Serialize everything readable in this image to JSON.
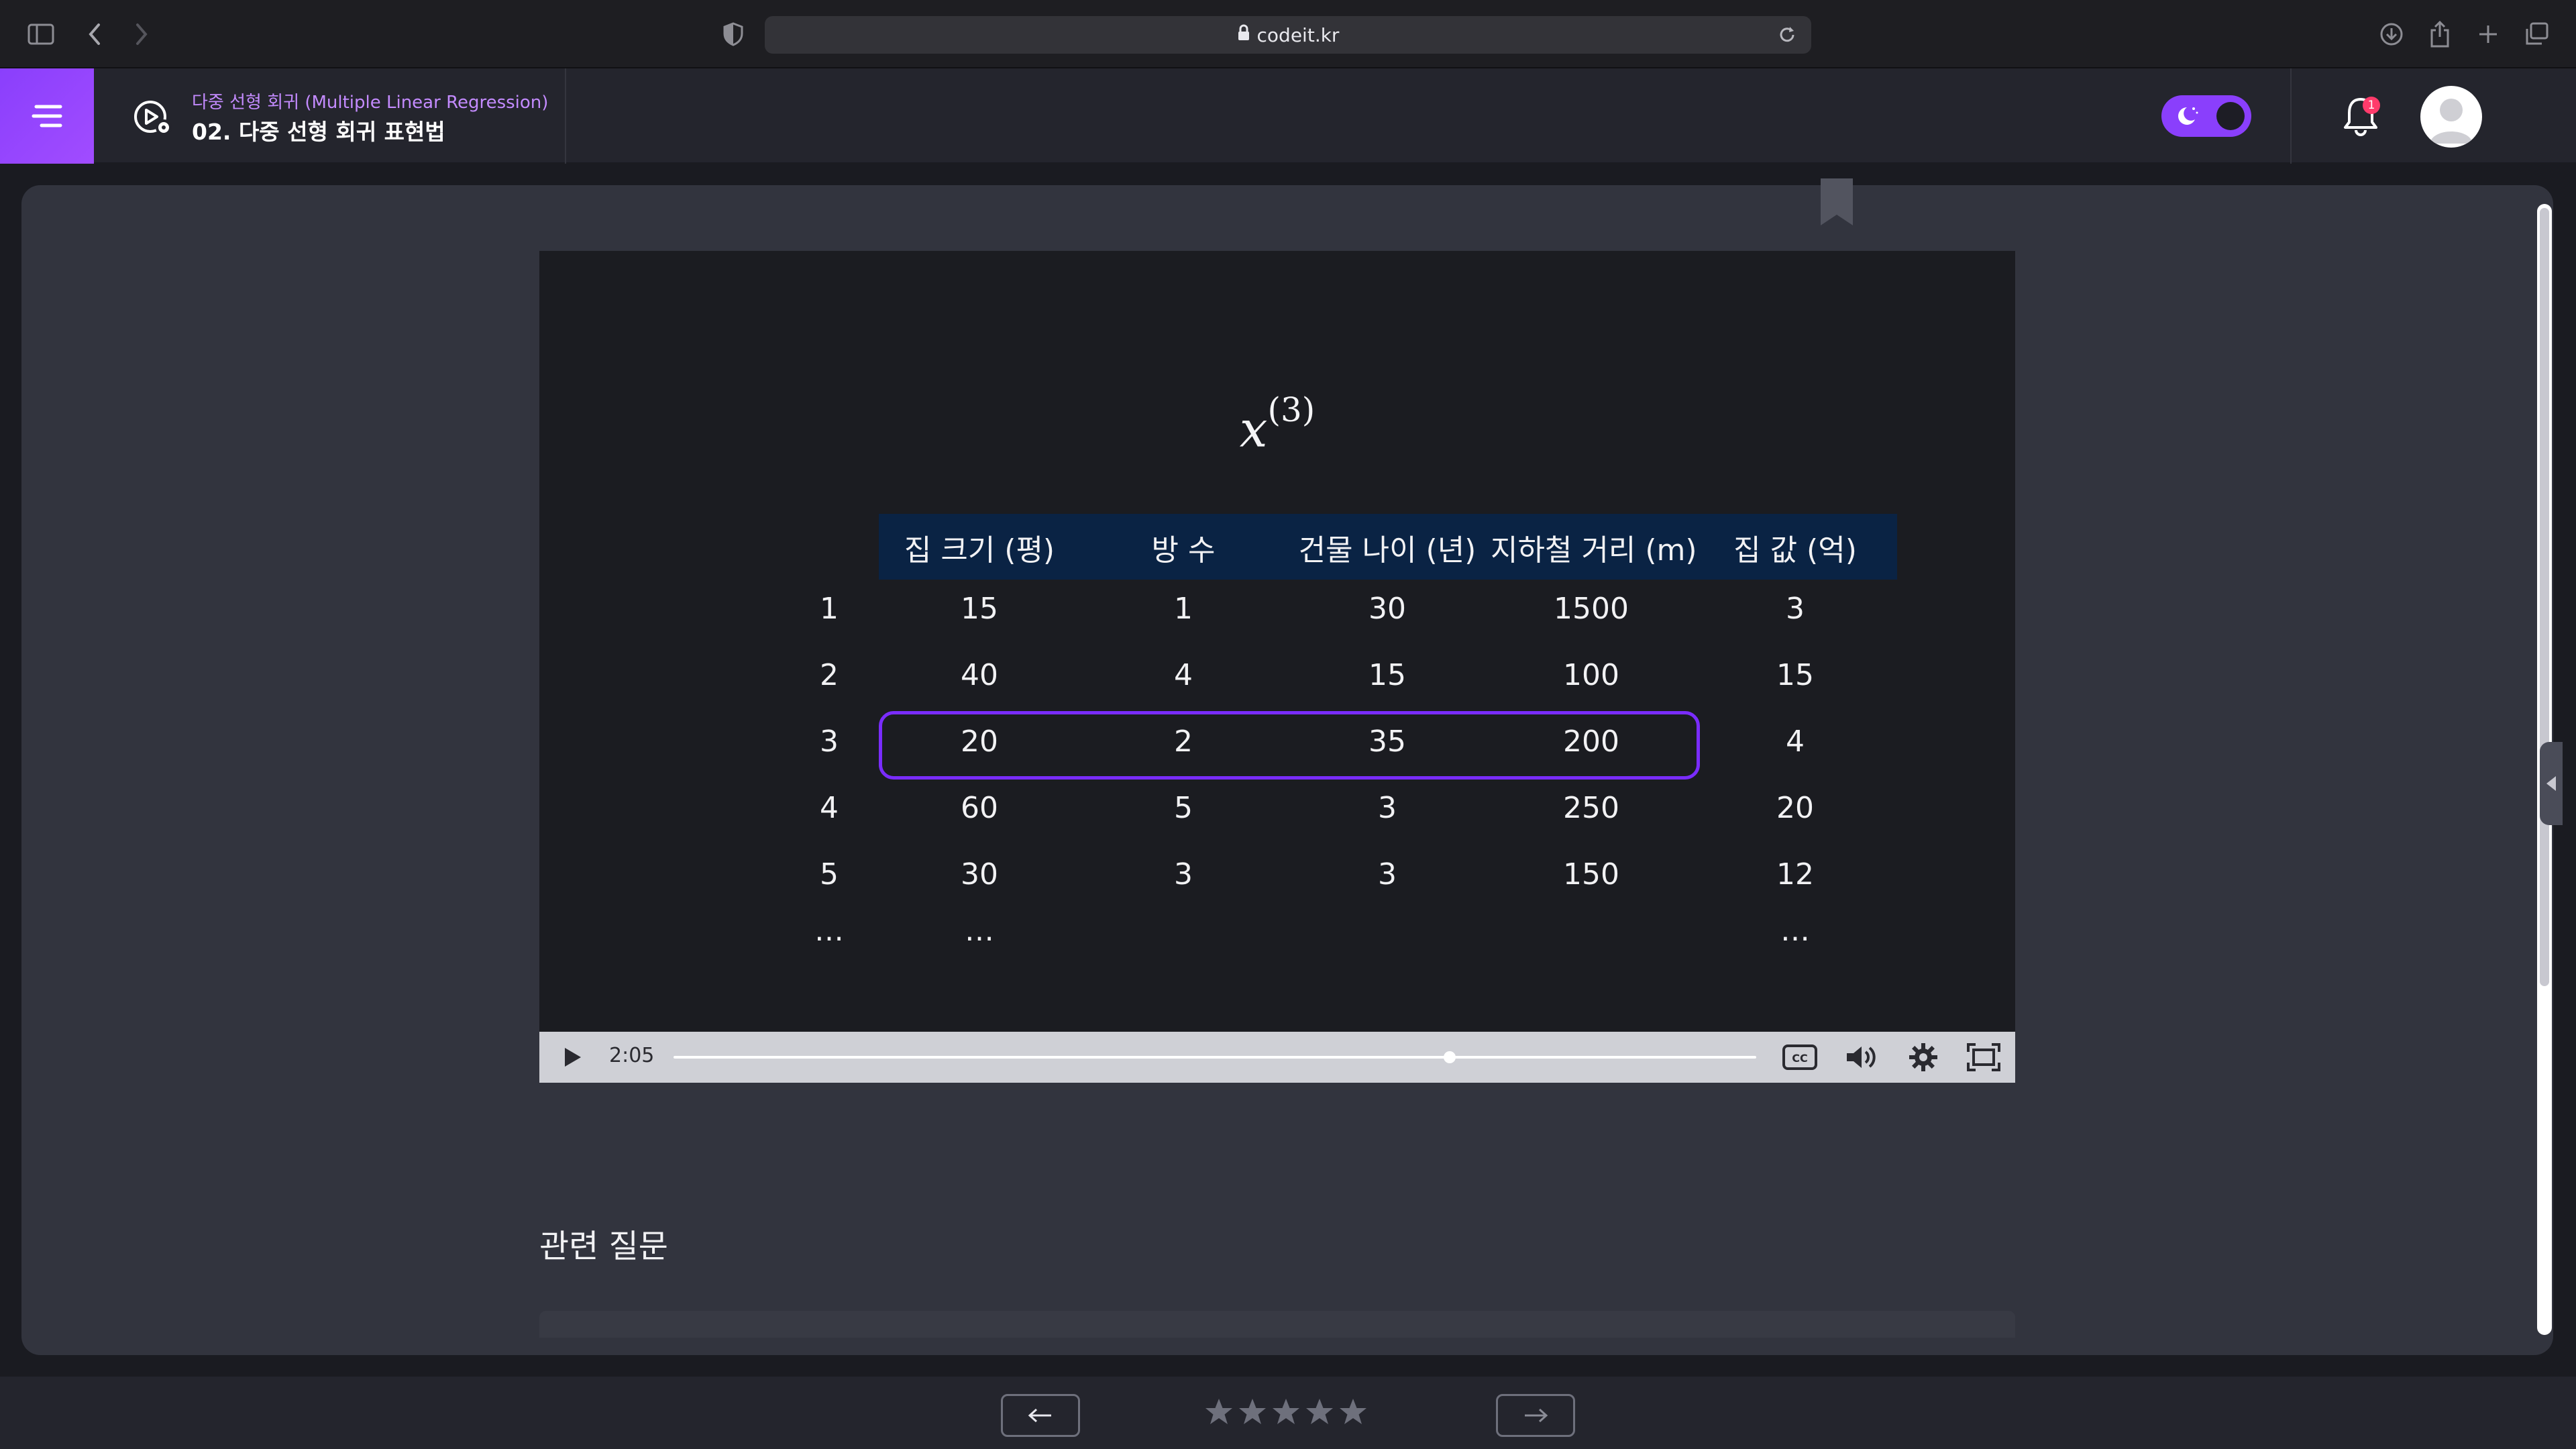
{
  "browser": {
    "url": "codeit.kr"
  },
  "header": {
    "course": "다중 선형 회귀 (Multiple Linear Regression)",
    "lesson": "02. 다중 선형 회귀 표현법",
    "notification_count": "1",
    "theme": "dark"
  },
  "video": {
    "formula_var": "x",
    "formula_sup": "(3)",
    "columns": [
      "집 크기 (평)",
      "방 수",
      "건물 나이 (년)",
      "지하철 거리 (m)",
      "집 값 (억)"
    ],
    "rows": [
      {
        "idx": "1",
        "cells": [
          "15",
          "1",
          "30",
          "1500",
          "3"
        ]
      },
      {
        "idx": "2",
        "cells": [
          "40",
          "4",
          "15",
          "100",
          "15"
        ]
      },
      {
        "idx": "3",
        "cells": [
          "20",
          "2",
          "35",
          "200",
          "4"
        ]
      },
      {
        "idx": "4",
        "cells": [
          "60",
          "5",
          "3",
          "250",
          "20"
        ]
      },
      {
        "idx": "5",
        "cells": [
          "30",
          "3",
          "3",
          "150",
          "12"
        ]
      }
    ],
    "ellipsis": "…",
    "highlighted_row": 3,
    "time": "2:05",
    "progress_fraction": 0.717
  },
  "related": {
    "title": "관련 질문"
  },
  "rating": {
    "max_stars": 5,
    "value": 0
  },
  "colors": {
    "accent": "#8a3ffc",
    "highlight": "#7a2cff",
    "table_header": "#0a2344"
  }
}
